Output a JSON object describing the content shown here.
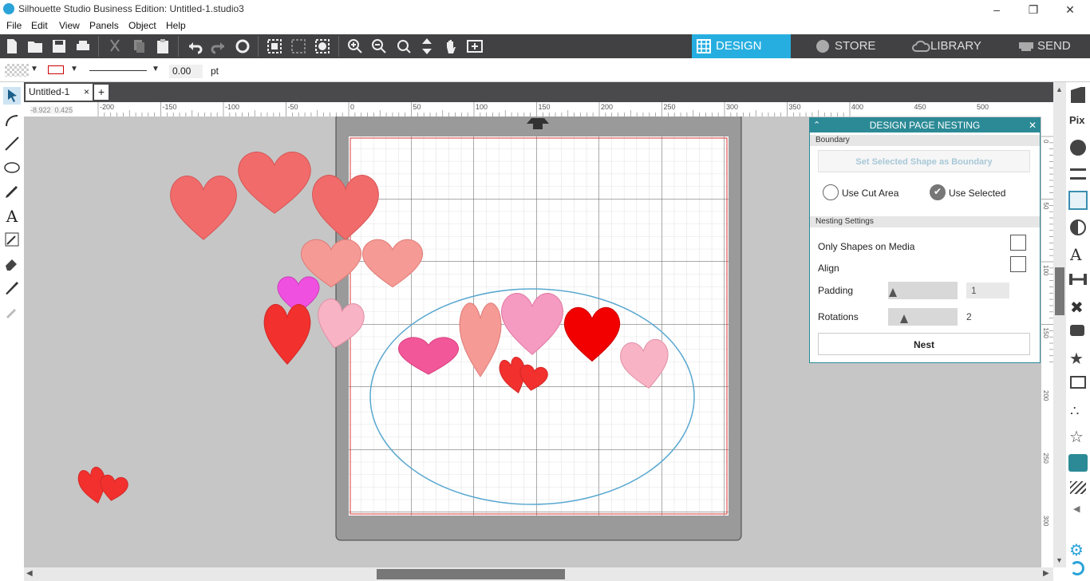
{
  "window": {
    "title": "Silhouette Studio Business Edition: Untitled-1.studio3"
  },
  "menu": [
    "File",
    "Edit",
    "View",
    "Panels",
    "Object",
    "Help"
  ],
  "nav_tabs": [
    {
      "label": "DESIGN",
      "active": true
    },
    {
      "label": "STORE",
      "active": false
    },
    {
      "label": "LIBRARY",
      "active": false
    },
    {
      "label": "SEND",
      "active": false
    }
  ],
  "properties": {
    "line_width": "0.00",
    "unit": "pt"
  },
  "document_tab": {
    "label": "Untitled-1",
    "close": "×",
    "add": "+"
  },
  "cursor_readout": {
    "x": "-8.922",
    "y": "0.425"
  },
  "ruler": {
    "h_labels": [
      "-200",
      "-150",
      "-100",
      "-50",
      "0",
      "50",
      "100",
      "150",
      "200",
      "250",
      "300",
      "350",
      "400",
      "450",
      "500"
    ],
    "v_labels": [
      "0",
      "50",
      "100",
      "150",
      "200",
      "250",
      "300"
    ]
  },
  "panel": {
    "title": "DESIGN PAGE NESTING",
    "boundary_section": "Boundary",
    "set_boundary_button": "Set Selected Shape as Boundary",
    "use_cut_area": "Use Cut Area",
    "use_selected": "Use Selected",
    "use_selected_checked": true,
    "nesting_section": "Nesting Settings",
    "only_shapes_on_media": "Only Shapes on Media",
    "only_shapes_on_media_checked": false,
    "align": "Align",
    "align_checked": false,
    "padding_label": "Padding",
    "padding_value": "1",
    "rotations_label": "Rotations",
    "rotations_value": "2",
    "nest_button": "Nest"
  },
  "colors": {
    "toolbar": "#414143",
    "design_tab": "#27aee0",
    "panel_header": "#2b8a96",
    "canvas": "#c6c6c6",
    "boundary_ellipse": "#5aa8d0"
  }
}
